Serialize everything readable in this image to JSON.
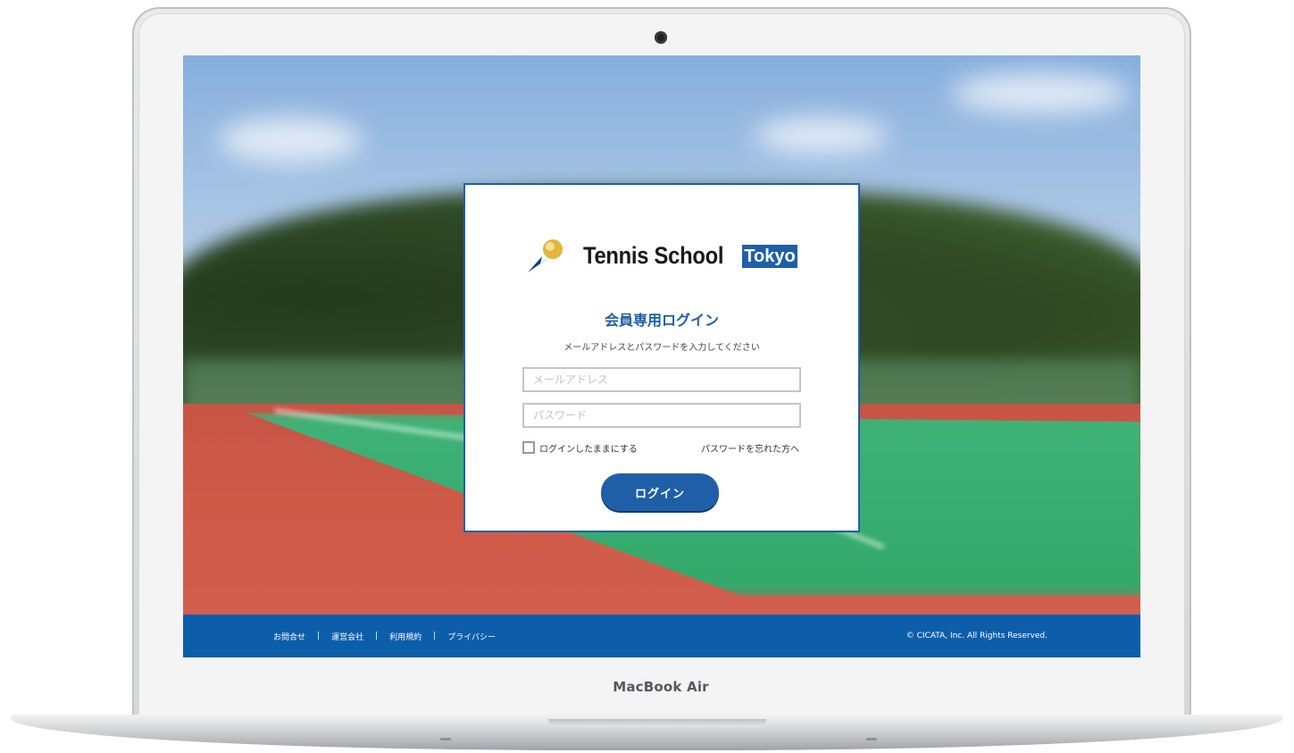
{
  "device": {
    "brand_label": "MacBook Air"
  },
  "login": {
    "logo_text": "Tennis School",
    "logo_badge": "Tokyo",
    "title": "会員専用ログイン",
    "instruction": "メールアドレスとパスワードを入力してください",
    "email_placeholder": "メールアドレス",
    "password_placeholder": "パスワード",
    "remember_label": "ログインしたままにする",
    "forgot_link": "パスワードを忘れた方へ",
    "submit_label": "ログイン"
  },
  "footer": {
    "links": [
      "お問合せ",
      "運営会社",
      "利用規約",
      "プライバシー"
    ],
    "separator": "|",
    "copyright": "© CICATA, Inc. All Rights Reserved."
  },
  "colors": {
    "brand_blue": "#1f5fa8",
    "footer_blue": "#0d5eaa"
  }
}
